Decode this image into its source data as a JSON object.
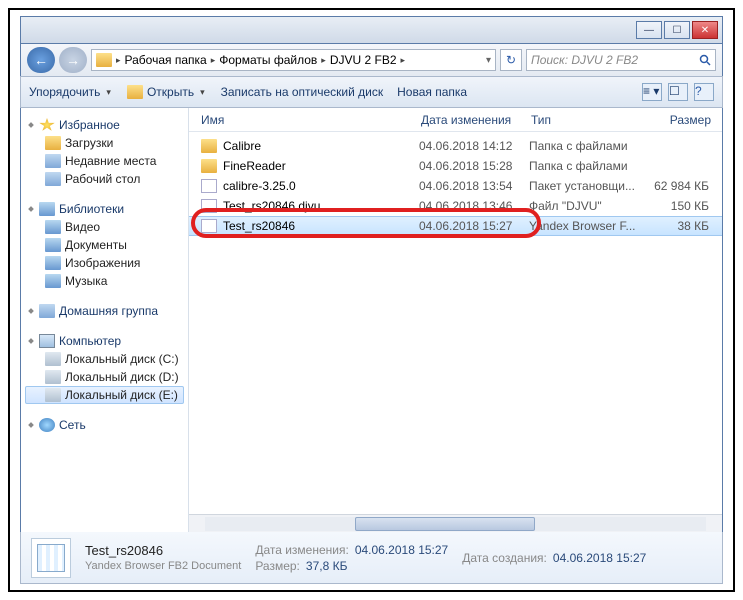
{
  "window": {
    "min": "—",
    "max": "☐",
    "close": "✕"
  },
  "breadcrumb": [
    "Рабочая папка",
    "Форматы файлов",
    "DJVU 2 FB2"
  ],
  "search": {
    "placeholder": "Поиск: DJVU 2 FB2"
  },
  "toolbar": {
    "organize": "Упорядочить",
    "open": "Открыть",
    "burn": "Записать на оптический диск",
    "new_folder": "Новая папка"
  },
  "sidebar": {
    "favorites": {
      "label": "Избранное",
      "items": [
        "Загрузки",
        "Недавние места",
        "Рабочий стол"
      ]
    },
    "libraries": {
      "label": "Библиотеки",
      "items": [
        "Видео",
        "Документы",
        "Изображения",
        "Музыка"
      ]
    },
    "homegroup": {
      "label": "Домашняя группа"
    },
    "computer": {
      "label": "Компьютер",
      "items": [
        "Локальный диск (C:)",
        "Локальный диск (D:)",
        "Локальный диск (E:)"
      ]
    },
    "network": {
      "label": "Сеть"
    }
  },
  "columns": {
    "name": "Имя",
    "date": "Дата изменения",
    "type": "Тип",
    "size": "Размер"
  },
  "files": [
    {
      "name": "Calibre",
      "date": "04.06.2018 14:12",
      "type": "Папка с файлами",
      "size": ""
    },
    {
      "name": "FineReader",
      "date": "04.06.2018 15:28",
      "type": "Папка с файлами",
      "size": ""
    },
    {
      "name": "calibre-3.25.0",
      "date": "04.06.2018 13:54",
      "type": "Пакет установщи...",
      "size": "62 984 КБ"
    },
    {
      "name": "Test_rs20846.djvu",
      "date": "04.06.2018 13:46",
      "type": "Файл \"DJVU\"",
      "size": "150 КБ"
    },
    {
      "name": "Test_rs20846",
      "date": "04.06.2018 15:27",
      "type": "Yandex Browser F...",
      "size": "38 КБ"
    }
  ],
  "details": {
    "name": "Test_rs20846",
    "type": "Yandex Browser FB2 Document",
    "mod_label": "Дата изменения:",
    "mod_val": "04.06.2018 15:27",
    "size_label": "Размер:",
    "size_val": "37,8 КБ",
    "created_label": "Дата создания:",
    "created_val": "04.06.2018 15:27"
  }
}
